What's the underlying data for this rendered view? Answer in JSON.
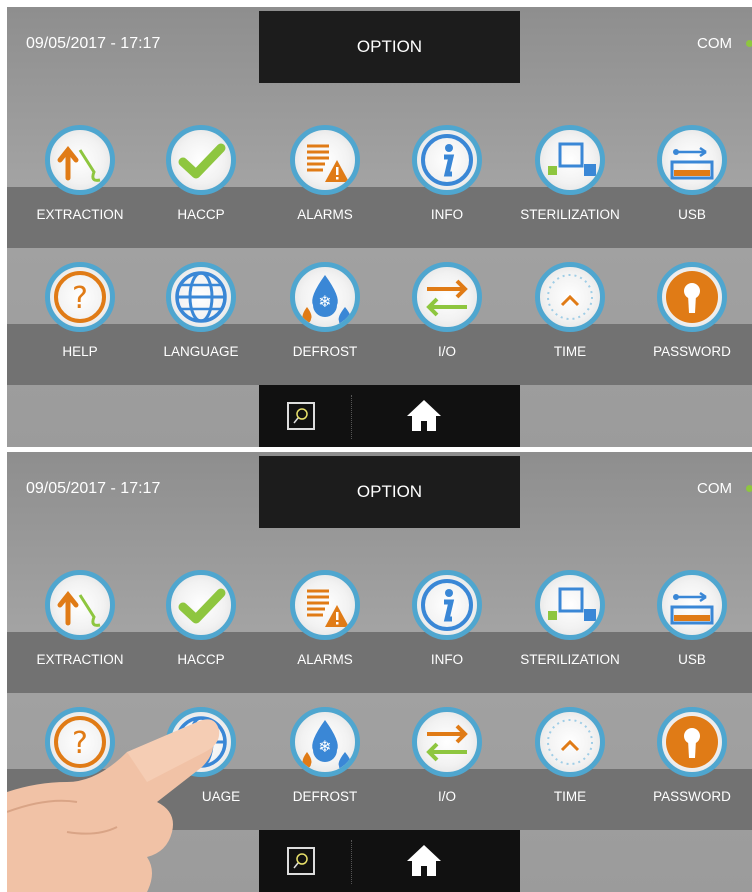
{
  "header": {
    "datetime": "09/05/2017 - 17:17",
    "title": "OPTION",
    "com_label": "COM"
  },
  "tiles": [
    {
      "label": "EXTRACTION",
      "icon": "extraction-icon"
    },
    {
      "label": "HACCP",
      "icon": "checkmark-icon"
    },
    {
      "label": "ALARMS",
      "icon": "alarm-warning-icon"
    },
    {
      "label": "INFO",
      "icon": "info-icon"
    },
    {
      "label": "STERILIZATION",
      "icon": "sterilization-icon"
    },
    {
      "label": "USB",
      "icon": "usb-icon"
    },
    {
      "label": "HELP",
      "icon": "help-icon"
    },
    {
      "label": "LANGUAGE",
      "icon": "globe-icon"
    },
    {
      "label": "DEFROST",
      "icon": "defrost-icon"
    },
    {
      "label": "I/O",
      "icon": "arrows-io-icon"
    },
    {
      "label": "TIME",
      "icon": "clock-icon"
    },
    {
      "label": "PASSWORD",
      "icon": "keyhole-icon"
    }
  ],
  "bottom_bar": {
    "left_icon": "light-bulb-icon",
    "right_icon": "home-icon"
  },
  "second_screen": {
    "tiles_labels": [
      "EXTRACTION",
      "HACCP",
      "ALARMS",
      "INFO",
      "STERILIZATION",
      "USB",
      "HELP",
      "UAGE",
      "DEFROST",
      "I/O",
      "TIME",
      "PASSWORD"
    ]
  },
  "colors": {
    "ring": "#4fa6cf",
    "orange": "#e07b16",
    "green": "#8ec63f",
    "blue": "#3a87d6",
    "band": "#727272"
  }
}
